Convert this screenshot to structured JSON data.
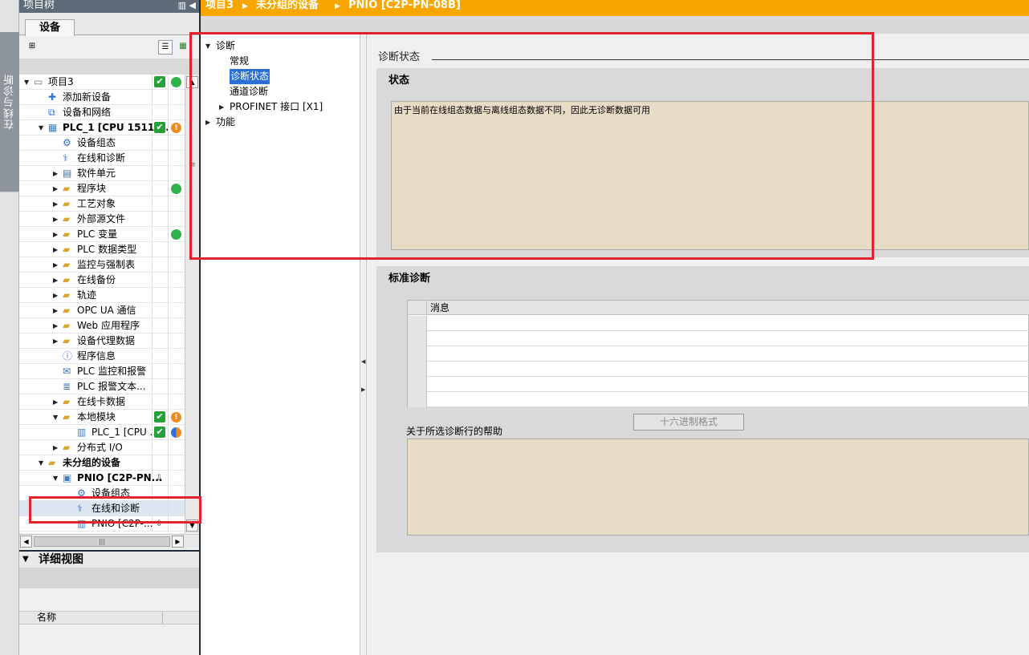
{
  "side_tab": {
    "label": "在线与诊断"
  },
  "project_tree": {
    "title": "项目树",
    "tab": "设备",
    "items": [
      {
        "label": "项目3",
        "indent": 0,
        "arrow": "down",
        "icon": "project-icon",
        "s1": "ok",
        "s2": "green"
      },
      {
        "label": "添加新设备",
        "indent": 1,
        "arrow": "",
        "icon": "add-device-icon"
      },
      {
        "label": "设备和网络",
        "indent": 1,
        "arrow": "",
        "icon": "network-icon"
      },
      {
        "label": "PLC_1 [CPU 1511-...",
        "indent": 1,
        "arrow": "down",
        "icon": "plc-icon",
        "bold": true,
        "s1": "ok",
        "s2": "warn"
      },
      {
        "label": "设备组态",
        "indent": 2,
        "arrow": "",
        "icon": "device-config-icon"
      },
      {
        "label": "在线和诊断",
        "indent": 2,
        "arrow": "",
        "icon": "diagnostics-icon"
      },
      {
        "label": "软件单元",
        "indent": 2,
        "arrow": "right",
        "icon": "software-unit-icon"
      },
      {
        "label": "程序块",
        "indent": 2,
        "arrow": "right",
        "icon": "folder-icon",
        "s2": "green"
      },
      {
        "label": "工艺对象",
        "indent": 2,
        "arrow": "right",
        "icon": "folder-icon"
      },
      {
        "label": "外部源文件",
        "indent": 2,
        "arrow": "right",
        "icon": "folder-icon"
      },
      {
        "label": "PLC 变量",
        "indent": 2,
        "arrow": "right",
        "icon": "folder-icon",
        "s2": "green"
      },
      {
        "label": "PLC 数据类型",
        "indent": 2,
        "arrow": "right",
        "icon": "folder-icon"
      },
      {
        "label": "监控与强制表",
        "indent": 2,
        "arrow": "right",
        "icon": "folder-icon"
      },
      {
        "label": "在线备份",
        "indent": 2,
        "arrow": "right",
        "icon": "folder-icon"
      },
      {
        "label": "轨迹",
        "indent": 2,
        "arrow": "right",
        "icon": "folder-icon"
      },
      {
        "label": "OPC UA 通信",
        "indent": 2,
        "arrow": "right",
        "icon": "folder-icon"
      },
      {
        "label": "Web 应用程序",
        "indent": 2,
        "arrow": "right",
        "icon": "folder-icon"
      },
      {
        "label": "设备代理数据",
        "indent": 2,
        "arrow": "right",
        "icon": "folder-icon"
      },
      {
        "label": "程序信息",
        "indent": 2,
        "arrow": "",
        "icon": "program-info-icon"
      },
      {
        "label": "PLC 监控和报警",
        "indent": 2,
        "arrow": "",
        "icon": "alarm-icon"
      },
      {
        "label": "PLC 报警文本...",
        "indent": 2,
        "arrow": "",
        "icon": "text-icon"
      },
      {
        "label": "在线卡数据",
        "indent": 2,
        "arrow": "right",
        "icon": "folder-icon"
      },
      {
        "label": "本地模块",
        "indent": 2,
        "arrow": "down",
        "icon": "folder-icon",
        "s1": "ok",
        "s2": "warn"
      },
      {
        "label": "PLC_1 [CPU ...",
        "indent": 3,
        "arrow": "",
        "icon": "plc-module-icon",
        "s1": "ok",
        "s2": "half"
      },
      {
        "label": "分布式 I/O",
        "indent": 2,
        "arrow": "right",
        "icon": "folder-icon"
      },
      {
        "label": "未分组的设备",
        "indent": 1,
        "arrow": "down",
        "icon": "folder-icon",
        "bold": true
      },
      {
        "label": "PNIO [C2P-PN...",
        "indent": 2,
        "arrow": "down",
        "icon": "device-icon",
        "bold": true,
        "s1": "download"
      },
      {
        "label": "设备组态",
        "indent": 3,
        "arrow": "",
        "icon": "device-config-icon"
      },
      {
        "label": "在线和诊断",
        "indent": 3,
        "arrow": "",
        "icon": "diagnostics-icon",
        "selected": true
      },
      {
        "label": "PNIO [C2P-...",
        "indent": 3,
        "arrow": "",
        "icon": "plc-module-icon",
        "s1": "download"
      }
    ]
  },
  "detail_view": {
    "title": "详细视图",
    "column_name": "名称"
  },
  "breadcrumb": [
    "项目3",
    "未分组的设备",
    "PNIO [C2P-PN-08B]"
  ],
  "nav": {
    "items": [
      {
        "label": "诊断",
        "indent": 0,
        "arrow": "down"
      },
      {
        "label": "常规",
        "indent": 1,
        "arrow": ""
      },
      {
        "label": "诊断状态",
        "indent": 1,
        "arrow": "",
        "selected": true
      },
      {
        "label": "通道诊断",
        "indent": 1,
        "arrow": ""
      },
      {
        "label": "PROFINET 接口 [X1]",
        "indent": 1,
        "arrow": "right"
      },
      {
        "label": "功能",
        "indent": 0,
        "arrow": "right"
      }
    ]
  },
  "content": {
    "section_title": "诊断状态",
    "status": {
      "title": "状态",
      "text": "由于当前在线组态数据与离线组态数据不同，因此无诊断数据可用"
    },
    "standard": {
      "title": "标准诊断",
      "column_message": "消息",
      "rows": 6,
      "hex_button": "十六进制格式",
      "help_label": "关于所选诊断行的帮助"
    }
  },
  "colors": {
    "accent": "#f7a600",
    "highlight": "#e4222f",
    "selection": "#2a6fd6",
    "text_area": "#e9dcc6"
  }
}
